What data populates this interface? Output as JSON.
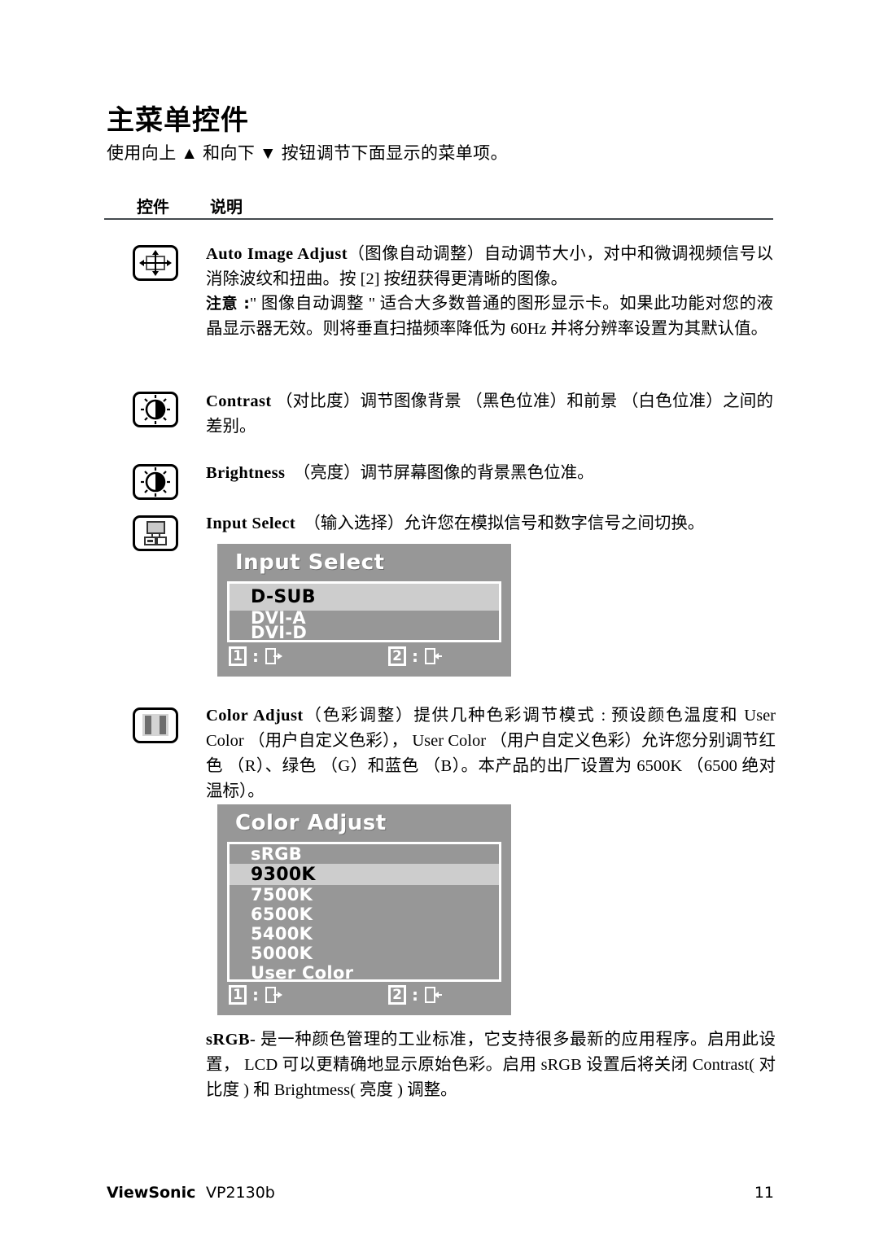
{
  "header": {
    "title": "主菜单控件",
    "subtitle": "使用向上 ▲ 和向下 ▼ 按钮调节下面显示的菜单项。"
  },
  "table_headers": {
    "control": "控件",
    "description": "说明"
  },
  "entries": {
    "auto_image_adjust": {
      "icon_name": "auto-image-adjust-icon",
      "term_en": "Auto Image Adjust",
      "body": "（图像自动调整）自动调节大小，对中和微调视频信号以消除波纹和扭曲。按 [2] 按纽获得更清晰的图像。",
      "note_label": "注意 :",
      "note_body": "\" 图像自动调整 \" 适合大多数普通的图形显示卡。如果此功能对您的液晶显示器无效。则将垂直扫描频率降低为 60Hz 并将分辨率设置为其默认值。"
    },
    "contrast": {
      "icon_name": "contrast-icon",
      "term_en": "Contrast",
      "body": "（对比度）调节图像背景 （黑色位准）和前景 （白色位准）之间的差别。"
    },
    "brightness": {
      "icon_name": "brightness-icon",
      "term_en": "Brightness",
      "body": "（亮度）调节屏幕图像的背景黑色位准。"
    },
    "input_select": {
      "icon_name": "input-select-icon",
      "term_en": "Input Select",
      "body": "（输入选择）允许您在模拟信号和数字信号之间切换。"
    },
    "color_adjust": {
      "icon_name": "color-adjust-icon",
      "term_en": "Color Adjust",
      "body": "（色彩调整）提供几种色彩调节模式 : 预设颜色温度和 User Color （用户自定义色彩）， User Color （用户自定义色彩）允许您分别调节红色 （R）、绿色 （G）和蓝色 （B）。本产品的出厂设置为 6500K （6500 绝对温标）。"
    },
    "srgb_note": {
      "term_en": "sRGB-",
      "body": "是一种颜色管理的工业标准，它支持很多最新的应用程序。启用此设置， LCD 可以更精确地显示原始色彩。启用 sRGB 设置后将关闭 Contrast( 对比度 ) 和 Brightmess( 亮度 ) 调整。"
    }
  },
  "osd_input_select": {
    "title": "Input Select",
    "items": [
      {
        "label": "D-SUB",
        "selected": true
      },
      {
        "label": "DVI-A",
        "selected": false
      },
      {
        "label": "DVI-D",
        "selected": false
      }
    ],
    "footer": {
      "key1": "1",
      "colon1": ":",
      "icon1": "exit-icon",
      "key2": "2",
      "colon2": ":",
      "icon2": "enter-icon"
    }
  },
  "osd_color_adjust": {
    "title": "Color Adjust",
    "items": [
      {
        "label": "sRGB",
        "selected": false
      },
      {
        "label": "9300K",
        "selected": true
      },
      {
        "label": "7500K",
        "selected": false
      },
      {
        "label": "6500K",
        "selected": false
      },
      {
        "label": "5400K",
        "selected": false
      },
      {
        "label": "5000K",
        "selected": false
      },
      {
        "label": "User Color",
        "selected": false
      }
    ],
    "footer": {
      "key1": "1",
      "colon1": ":",
      "icon1": "exit-icon",
      "key2": "2",
      "colon2": ":",
      "icon2": "enter-icon"
    }
  },
  "footer": {
    "brand": "ViewSonic",
    "model": "VP2130b",
    "page_number": "11"
  },
  "colors": {
    "osd_background": "#979797",
    "osd_selected": "#cdcdcd",
    "osd_text": "#ffffff",
    "osd_selected_text": "#000000",
    "rule": "#444a4e"
  }
}
